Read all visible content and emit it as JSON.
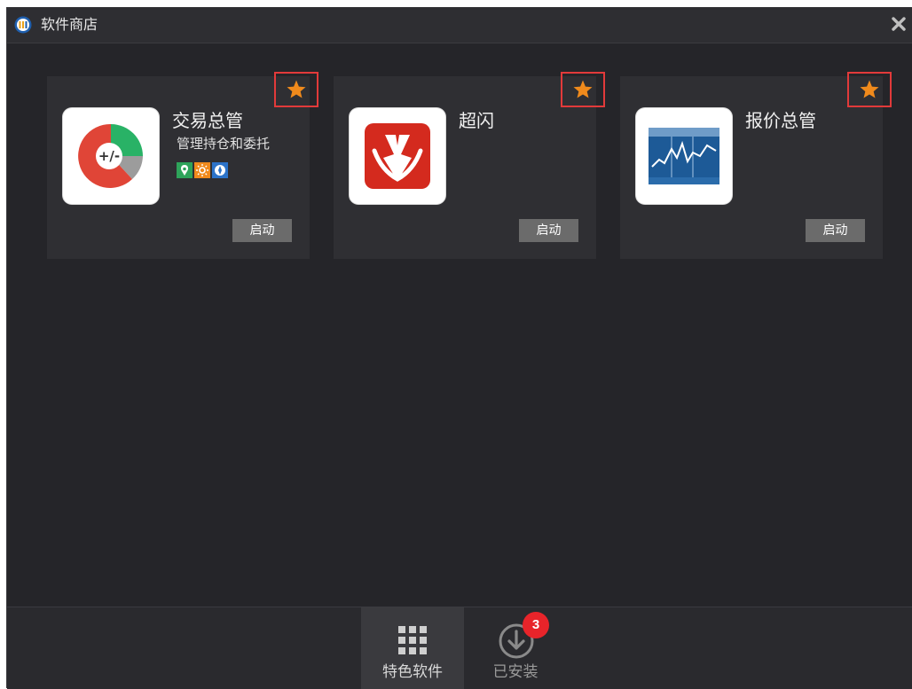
{
  "window": {
    "title": "软件商店",
    "logo_icon": "app-store-logo-icon",
    "close_icon": "close-icon"
  },
  "apps": [
    {
      "name": "交易总管",
      "description": "管理持仓和委托",
      "icon": "trade-manager-pie-icon",
      "tags": [
        "tag-green-icon",
        "tag-orange-icon",
        "tag-blue-icon"
      ],
      "favorite_icon": "star-icon",
      "launch_label": "启动"
    },
    {
      "name": "超闪",
      "description": "",
      "icon": "lightning-download-icon",
      "tags": [],
      "favorite_icon": "star-icon",
      "launch_label": "启动"
    },
    {
      "name": "报价总管",
      "description": "",
      "icon": "quote-chart-icon",
      "tags": [],
      "favorite_icon": "star-icon",
      "launch_label": "启动"
    }
  ],
  "bottom_tabs": [
    {
      "label": "特色软件",
      "icon": "grid-icon",
      "active": true
    },
    {
      "label": "已安装",
      "icon": "download-circle-icon",
      "active": false,
      "badge": "3"
    }
  ],
  "colors": {
    "background": "#252529",
    "card": "#2f2f33",
    "launch_button": "#6b6b6b",
    "star": "#f08a1c",
    "highlight_border": "#e23a3a",
    "badge": "#e8242a"
  }
}
